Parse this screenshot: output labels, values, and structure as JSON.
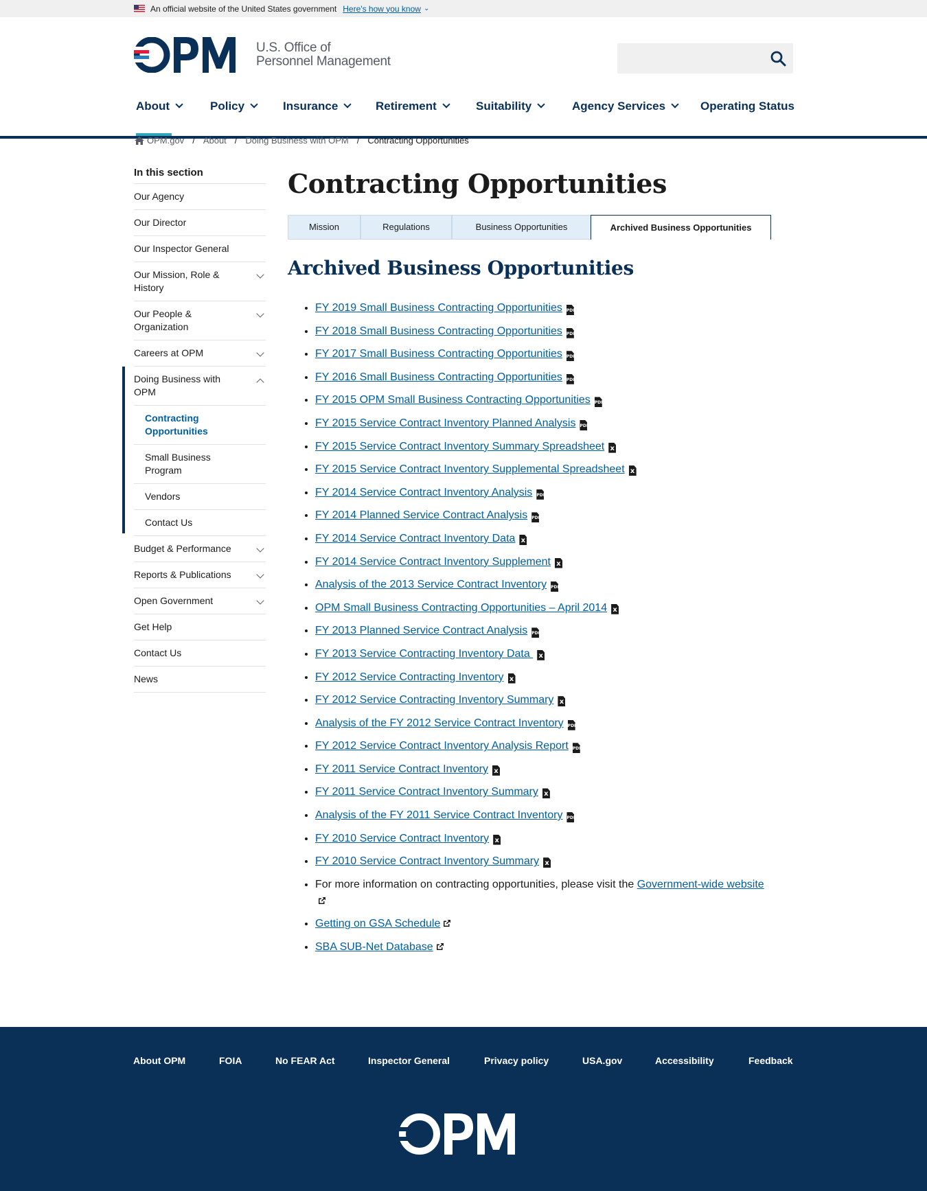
{
  "gov_banner": {
    "text": "An official website of the United States government",
    "link": "Here's how you know"
  },
  "header": {
    "logo_text": "OPM",
    "agency_line1": "U.S. Office of",
    "agency_line2": "Personnel Management",
    "search": {
      "placeholder": "",
      "value": ""
    }
  },
  "nav": [
    {
      "label": "About",
      "has_menu": true,
      "active": true
    },
    {
      "label": "Policy",
      "has_menu": true
    },
    {
      "label": "Insurance",
      "has_menu": true
    },
    {
      "label": "Retirement",
      "has_menu": true
    },
    {
      "label": "Suitability",
      "has_menu": true
    },
    {
      "label": "Agency Services",
      "has_menu": true
    },
    {
      "label": "Operating Status",
      "has_menu": false
    }
  ],
  "breadcrumb": [
    "OPM.gov",
    "About",
    "Doing Business with OPM",
    "Contracting Opportunities"
  ],
  "sidebar": {
    "title": "In this section",
    "items": [
      {
        "label": "Our Agency"
      },
      {
        "label": "Our Director"
      },
      {
        "label": "Our Inspector General"
      },
      {
        "label": "Our Mission, Role & History",
        "expandable": true
      },
      {
        "label": "Our People & Organization",
        "expandable": true
      },
      {
        "label": "Careers at OPM",
        "expandable": true
      },
      {
        "label": "Doing Business with OPM",
        "expandable": true,
        "expanded": true,
        "children": [
          {
            "label": "Contracting Opportunities",
            "current": true
          },
          {
            "label": "Small Business Program"
          },
          {
            "label": "Vendors"
          },
          {
            "label": "Contact Us"
          }
        ]
      },
      {
        "label": "Budget & Performance",
        "expandable": true
      },
      {
        "label": "Reports & Publications",
        "expandable": true
      },
      {
        "label": "Open Government",
        "expandable": true
      },
      {
        "label": "Get Help"
      },
      {
        "label": "Contact Us"
      },
      {
        "label": "News"
      }
    ]
  },
  "main": {
    "title": "Contracting Opportunities",
    "tabs": [
      "Mission",
      "Regulations",
      "Business Opportunities",
      "Archived Business Opportunities"
    ],
    "active_tab": "Archived Business Opportunities",
    "section_title": "Archived Business Opportunities",
    "documents": [
      {
        "label": "FY 2019 Small Business Contracting Opportunities",
        "icon": "pdf"
      },
      {
        "label": "FY 2018 Small Business Contracting Opportunities",
        "icon": "pdf"
      },
      {
        "label": "FY 2017 Small Business Contracting Opportunities",
        "icon": "pdf"
      },
      {
        "label": "FY 2016 Small Business Contracting Opportunities",
        "icon": "pdf"
      },
      {
        "label": "FY 2015 OPM Small Business Contracting Opportunities",
        "icon": "pdf"
      },
      {
        "label": "FY 2015 Service Contract Inventory Planned Analysis",
        "icon": "pdf"
      },
      {
        "label": "FY 2015 Service Contract Inventory Summary Spreadsheet",
        "icon": "excel"
      },
      {
        "label": "FY 2015 Service Contract Inventory Supplemental Spreadsheet",
        "icon": "excel"
      },
      {
        "label": "FY 2014 Service Contract Inventory Analysis",
        "icon": "pdf"
      },
      {
        "label": "FY 2014 Planned Service Contract Analysis",
        "icon": "pdf"
      },
      {
        "label": "FY 2014 Service Contract Inventory Data",
        "icon": "excel"
      },
      {
        "label": "FY 2014 Service Contract Inventory Supplement",
        "icon": "excel"
      },
      {
        "label": "Analysis of the 2013 Service Contract Inventory",
        "icon": "pdf"
      },
      {
        "label": "OPM Small Business Contracting Opportunities – April 2014",
        "icon": "excel"
      },
      {
        "label": "FY 2013 Planned Service Contract Analysis",
        "icon": "pdf"
      },
      {
        "label": "FY 2013 Service Contracting Inventory Data ",
        "icon": "excel"
      },
      {
        "label": "FY 2012 Service Contracting Inventory",
        "icon": "excel"
      },
      {
        "label": "FY 2012 Service Contracting Inventory Summary",
        "icon": "excel"
      },
      {
        "label": "Analysis of the FY 2012 Service Contract Inventory",
        "icon": "pdf"
      },
      {
        "label": "FY 2012 Service Contract Inventory Analysis Report",
        "icon": "pdf"
      },
      {
        "label": "FY 2011 Service Contract Inventory",
        "icon": "excel"
      },
      {
        "label": "FY 2011 Service Contract Inventory Summary",
        "icon": "excel"
      },
      {
        "label": "Analysis of the FY 2011 Service Contract Inventory",
        "icon": "pdf"
      },
      {
        "label": "FY 2010 Service Contract Inventory",
        "icon": "excel"
      },
      {
        "label": "FY 2010 Service Contract Inventory Summary",
        "icon": "excel"
      }
    ],
    "more_info": {
      "text": "For more information on contracting opportunities, please visit the ",
      "link": "Government-wide website"
    },
    "external_links": [
      "Getting on GSA Schedule",
      "SBA SUB-Net Database"
    ]
  },
  "footer": {
    "links": [
      "About OPM",
      "FOIA",
      "No FEAR Act",
      "Inspector General",
      "Privacy policy",
      "USA.gov",
      "Accessibility",
      "Feedback"
    ],
    "logo_text": "OPM"
  },
  "colors": {
    "navy": "#0a3057",
    "link": "#005ea2",
    "accent_teal": "#2fa6ba",
    "logo_red": "#e31c3d",
    "logo_blue": "#2b7bb9"
  }
}
